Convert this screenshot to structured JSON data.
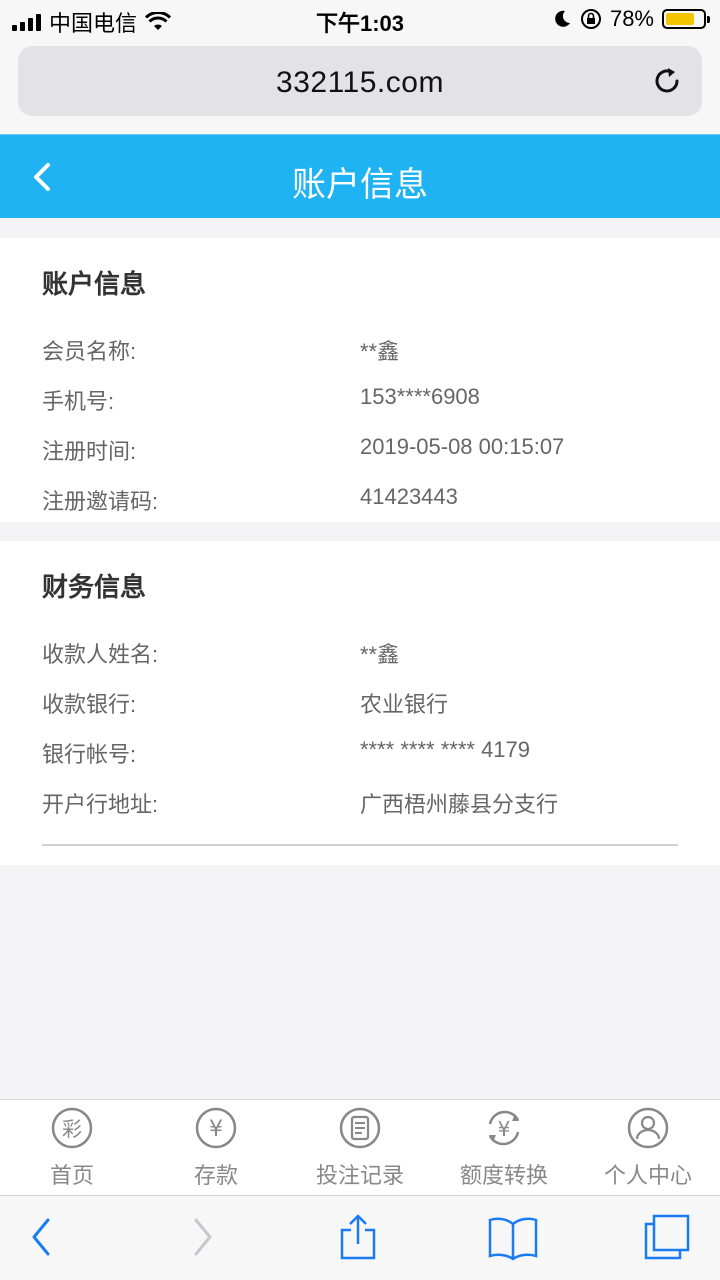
{
  "status_bar": {
    "carrier": "中国电信",
    "time": "下午1:03",
    "battery": "78%"
  },
  "browser": {
    "url": "332115.com"
  },
  "header": {
    "title": "账户信息"
  },
  "account_section": {
    "title": "账户信息",
    "rows": [
      {
        "label": "会员名称:",
        "value": "**鑫"
      },
      {
        "label": "手机号:",
        "value": "153****6908"
      },
      {
        "label": "注册时间:",
        "value": "2019-05-08 00:15:07"
      },
      {
        "label": "注册邀请码:",
        "value": "41423443"
      }
    ]
  },
  "finance_section": {
    "title": "财务信息",
    "rows": [
      {
        "label": "收款人姓名:",
        "value": "**鑫"
      },
      {
        "label": "收款银行:",
        "value": "农业银行"
      },
      {
        "label": "银行帐号:",
        "value": "**** **** **** 4179"
      },
      {
        "label": "开户行地址:",
        "value": "广西梧州藤县分支行"
      }
    ]
  },
  "tabbar": {
    "items": [
      {
        "label": "首页",
        "icon": "lottery-icon",
        "glyph": "彩"
      },
      {
        "label": "存款",
        "icon": "yuan-icon",
        "glyph": "¥"
      },
      {
        "label": "投注记录",
        "icon": "record-icon"
      },
      {
        "label": "额度转换",
        "icon": "exchange-icon",
        "glyph": "¥"
      },
      {
        "label": "个人中心",
        "icon": "user-icon"
      }
    ]
  },
  "colors": {
    "header_bg": "#1fb3f4",
    "page_bg": "#f3f3f5",
    "safari_blue": "#1a7cf5"
  }
}
